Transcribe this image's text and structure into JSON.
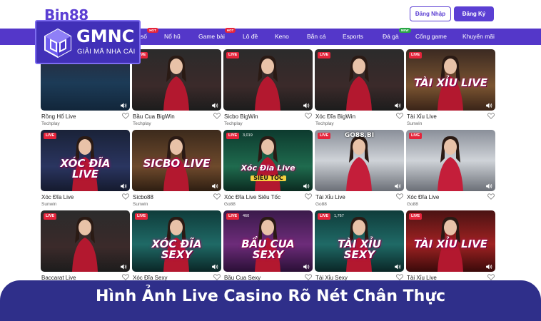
{
  "header": {
    "site_logo": "Bin88",
    "login_label": "Đăng Nhập",
    "register_label": "Đăng Ký"
  },
  "overlay_logo": {
    "title": "GMNC",
    "subtitle": "GIẢI MÃ NHÀ CÁI"
  },
  "nav": {
    "items": [
      {
        "label": "số",
        "badge": "HOT"
      },
      {
        "label": "Nổ hũ",
        "badge": ""
      },
      {
        "label": "Game bài",
        "badge": "HOT"
      },
      {
        "label": "Lô đề",
        "badge": ""
      },
      {
        "label": "Keno",
        "badge": ""
      },
      {
        "label": "Bắn cá",
        "badge": ""
      },
      {
        "label": "Esports",
        "badge": ""
      },
      {
        "label": "Đá gà",
        "badge": "NEW"
      },
      {
        "label": "Cổng game",
        "badge": ""
      },
      {
        "label": "Khuyến mãi",
        "badge": ""
      }
    ]
  },
  "games": [
    {
      "name": "Rồng Hổ Live",
      "provider": "Techplay",
      "live": "",
      "viewers": "",
      "art_text": "",
      "theme": "dragon-tiger"
    },
    {
      "name": "Bầu Cua BigWin",
      "provider": "Techplay",
      "live": "LIVE",
      "viewers": "",
      "art_text": "",
      "theme": "dealer-dark"
    },
    {
      "name": "Sicbo BigWin",
      "provider": "Techplay",
      "live": "LIVE",
      "viewers": "",
      "art_text": "",
      "theme": "dealer-dark"
    },
    {
      "name": "Xóc Đĩa BigWin",
      "provider": "Techplay",
      "live": "LIVE",
      "viewers": "",
      "art_text": "",
      "theme": "dealer-dark"
    },
    {
      "name": "Tài Xỉu Live",
      "provider": "Sunwin",
      "live": "LIVE",
      "viewers": "",
      "art_text": "TÀI XỈU LIVE",
      "theme": "gold"
    },
    {
      "name": "Xóc Đĩa Live",
      "provider": "Sunwin",
      "live": "LIVE",
      "viewers": "",
      "art_text": "XÓC ĐĨA LIVE",
      "theme": "navy"
    },
    {
      "name": "Sicbo88",
      "provider": "Sunwin",
      "live": "",
      "viewers": "",
      "art_text": "SICBO LIVE",
      "theme": "brown"
    },
    {
      "name": "Xóc Đĩa Live Siêu Tốc",
      "provider": "Go88",
      "live": "LIVE",
      "viewers": "3,019",
      "art_text": "Xóc Đĩa Live",
      "art_sub": "SIÊU TỐC",
      "theme": "green"
    },
    {
      "name": "Tài Xỉu Live",
      "provider": "Go88",
      "live": "LIVE",
      "viewers": "",
      "art_text": "GO88.BI",
      "theme": "studio"
    },
    {
      "name": "Xóc Đĩa Live",
      "provider": "Go88",
      "live": "LIVE",
      "viewers": "",
      "art_text": "",
      "theme": "studio"
    },
    {
      "name": "Baccarat Live",
      "provider": "",
      "live": "LIVE",
      "viewers": "",
      "art_text": "",
      "theme": "dealer-dark"
    },
    {
      "name": "Xóc Đĩa Sexy",
      "provider": "",
      "live": "LIVE",
      "viewers": "",
      "art_text": "XÓC ĐĨA SEXY",
      "theme": "teal"
    },
    {
      "name": "Bầu Cua Sexy",
      "provider": "",
      "live": "LIVE",
      "viewers": "460",
      "art_text": "BẦU CUA SEXY",
      "theme": "purple"
    },
    {
      "name": "Tài Xỉu Sexy",
      "provider": "",
      "live": "LIVE",
      "viewers": "1,767",
      "art_text": "TÀI XỈU SEXY",
      "theme": "teal"
    },
    {
      "name": "Tài Xỉu Live",
      "provider": "",
      "live": "LIVE",
      "viewers": "",
      "art_text": "TÀI XỈU LIVE",
      "theme": "red"
    }
  ],
  "banner": {
    "text": "Hình Ảnh Live Casino Rõ Nét Chân Thực"
  },
  "colors": {
    "brand": "#5437c9",
    "live": "#e5243b",
    "banner": "#2f2f8a"
  }
}
